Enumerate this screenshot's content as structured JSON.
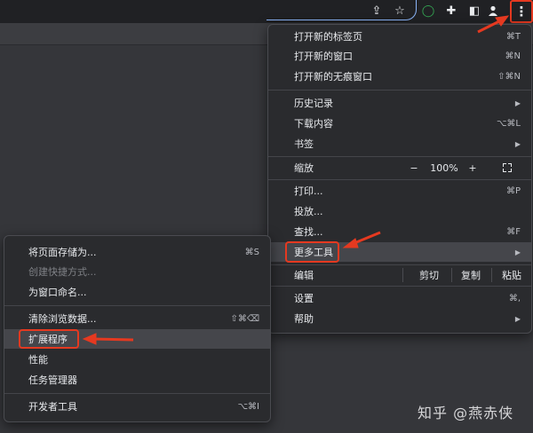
{
  "toolbar": {
    "icons": [
      "share-icon",
      "star-icon",
      "chat-icon",
      "puzzle-icon",
      "sidebar-icon",
      "profile-icon",
      "kebab-icon"
    ],
    "share_glyph": "⇪",
    "star_glyph": "☆",
    "chat_glyph": "◯",
    "ext_glyph": "✚",
    "side_glyph": "◧",
    "profile_glyph": "●",
    "kebab_glyph": "⋮"
  },
  "main_menu": {
    "new_tab": {
      "label": "打开新的标签页",
      "shortcut": "⌘T"
    },
    "new_window": {
      "label": "打开新的窗口",
      "shortcut": "⌘N"
    },
    "new_incognito": {
      "label": "打开新的无痕窗口",
      "shortcut": "⇧⌘N"
    },
    "history": {
      "label": "历史记录"
    },
    "downloads": {
      "label": "下载内容",
      "shortcut": "⌥⌘L"
    },
    "bookmarks": {
      "label": "书签"
    },
    "zoom": {
      "label": "缩放",
      "minus": "−",
      "value": "100%",
      "plus": "+"
    },
    "print": {
      "label": "打印...",
      "shortcut": "⌘P"
    },
    "cast": {
      "label": "投放..."
    },
    "find": {
      "label": "查找...",
      "shortcut": "⌘F"
    },
    "more_tools": {
      "label": "更多工具"
    },
    "edit": {
      "label": "编辑",
      "cut": "剪切",
      "copy": "复制",
      "paste": "粘贴"
    },
    "settings": {
      "label": "设置",
      "shortcut": "⌘,"
    },
    "help": {
      "label": "帮助"
    },
    "arrow": "▶"
  },
  "sub_menu": {
    "save_page": {
      "label": "将页面存储为...",
      "shortcut": "⌘S"
    },
    "create_shortcut": {
      "label": "创建快捷方式..."
    },
    "name_window": {
      "label": "为窗口命名..."
    },
    "clear_data": {
      "label": "清除浏览数据...",
      "shortcut": "⇧⌘⌫"
    },
    "extensions": {
      "label": "扩展程序"
    },
    "performance": {
      "label": "性能"
    },
    "task_manager": {
      "label": "任务管理器"
    },
    "dev_tools": {
      "label": "开发者工具",
      "shortcut": "⌥⌘I"
    }
  },
  "annotation_color": "#e53920",
  "watermark": "知乎 @燕赤侠"
}
